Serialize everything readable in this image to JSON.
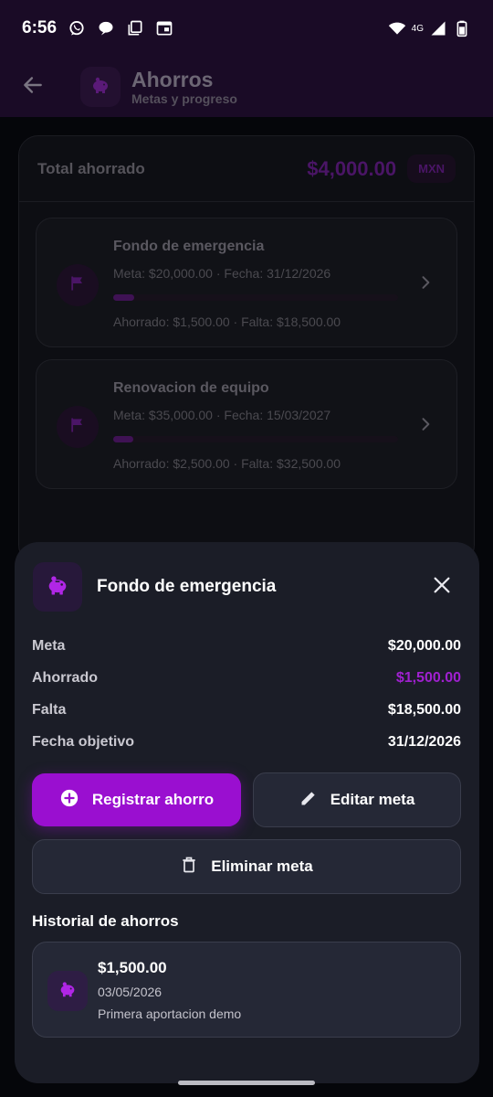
{
  "status_bar": {
    "time": "6:56",
    "network": "4G",
    "icons": [
      "whatsapp-icon",
      "chat-bubble-icon",
      "copy-icon",
      "calendar-icon",
      "wifi-icon",
      "signal-icon",
      "battery-icon"
    ]
  },
  "app_bar": {
    "title": "Ahorros",
    "subtitle": "Metas y progreso"
  },
  "summary": {
    "total_label": "Total ahorrado",
    "total_value": "$4,000.00",
    "currency": "MXN"
  },
  "goals": [
    {
      "name": "Fondo de emergencia",
      "meta": "Meta: $20,000.00 · Fecha: 31/12/2026",
      "saved": "Ahorrado: $1,500.00 · Falta: $18,500.00",
      "progress": 0.075
    },
    {
      "name": "Renovacion de equipo",
      "meta": "Meta: $35,000.00 · Fecha: 15/03/2027",
      "saved": "Ahorrado: $2,500.00 · Falta: $32,500.00",
      "progress": 0.071
    }
  ],
  "sheet": {
    "title": "Fondo de emergencia",
    "rows": [
      {
        "label": "Meta",
        "value": "$20,000.00"
      },
      {
        "label": "Ahorrado",
        "value": "$1,500.00"
      },
      {
        "label": "Falta",
        "value": "$18,500.00"
      },
      {
        "label": "Fecha objetivo",
        "value": "31/12/2026"
      }
    ],
    "primary_button": "Registrar ahorro",
    "edit_button": "Editar meta",
    "delete_button": "Eliminar meta",
    "history_title": "Historial de ahorros",
    "history": [
      {
        "amount": "$1,500.00",
        "date": "03/05/2026",
        "note": "Primera aportacion demo"
      }
    ]
  },
  "colors": {
    "accent": "#9a0fd0",
    "accent_text": "#a020d0",
    "sheet_bg": "#1b1d27",
    "app_bar_bg": "#1a0b26"
  }
}
